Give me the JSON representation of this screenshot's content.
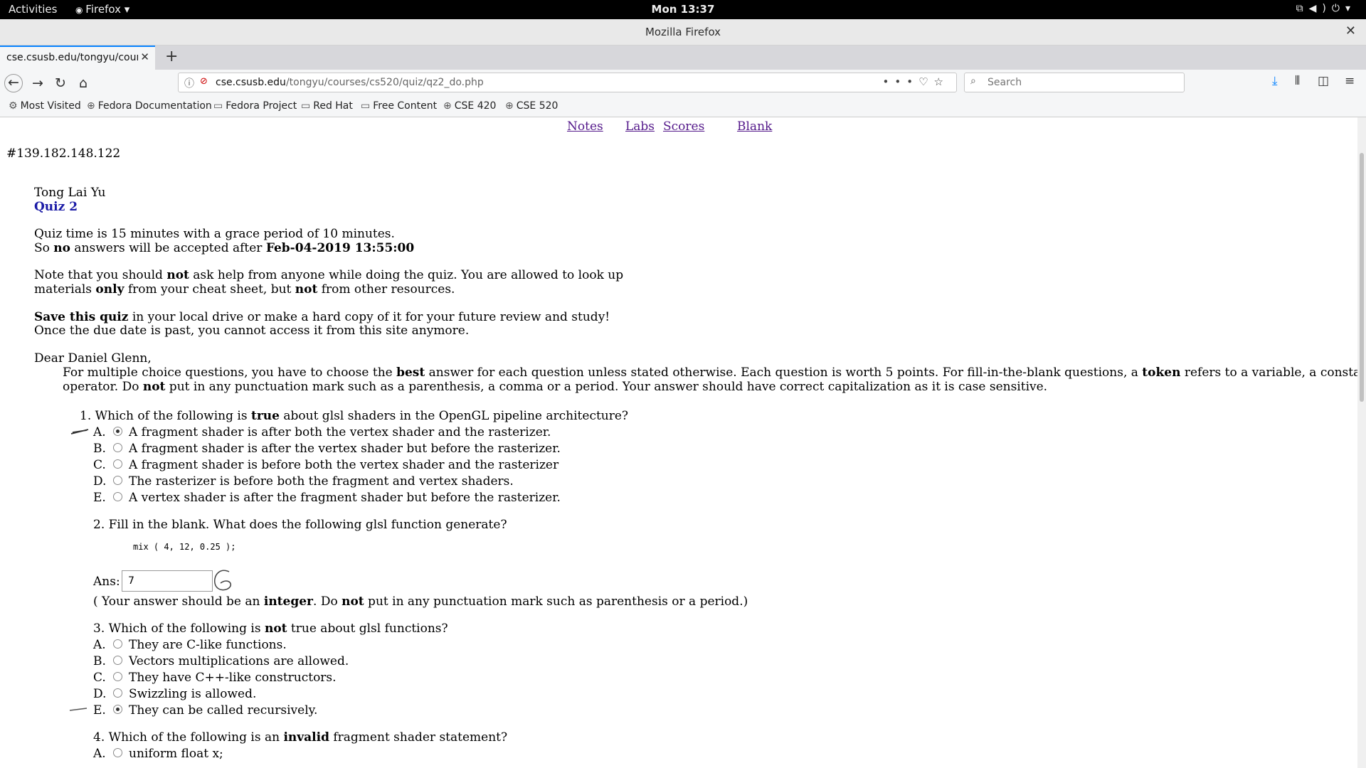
{
  "system": {
    "activities": "Activities",
    "app_menu": "Firefox ▾",
    "clock": "Mon 13:37"
  },
  "window": {
    "title": "Mozilla Firefox"
  },
  "tab": {
    "title": "cse.csusb.edu/tongyu/course"
  },
  "urlbar": {
    "host": "cse.csusb.edu",
    "path": "/tongyu/courses/cs520/quiz/qz2_do.php"
  },
  "search": {
    "placeholder": "Search"
  },
  "bookmarks": [
    {
      "label": "Most Visited",
      "icon": "gear-icon"
    },
    {
      "label": "Fedora Documentation",
      "icon": "globe-icon"
    },
    {
      "label": "Fedora Project",
      "icon": "folder-icon"
    },
    {
      "label": "Red Hat",
      "icon": "folder-icon"
    },
    {
      "label": "Free Content",
      "icon": "folder-icon"
    },
    {
      "label": "CSE 420",
      "icon": "globe-icon"
    },
    {
      "label": "CSE 520",
      "icon": "globe-icon"
    }
  ],
  "page": {
    "top_links": [
      "Notes",
      "Labs",
      "Scores",
      "Blank"
    ],
    "ip": "#139.182.148.122",
    "author": "Tong Lai Yu",
    "quiz_title": "Quiz 2",
    "intro1_a": "Quiz time is 15 minutes with a grace period of 10 minutes.",
    "intro1_b_pre": "So ",
    "intro1_b_bold": "no",
    "intro1_b_mid": " answers will be accepted after ",
    "intro1_b_date": "Feb-04-2019 13:55:00",
    "note_1": "Note that you should ",
    "note_2": "not",
    "note_3": " ask help from anyone while doing the quiz. You are allowed to look up",
    "note_4": "materials ",
    "note_5": "only",
    "note_6": " from your cheat sheet, but ",
    "note_7": "not",
    "note_8": " from other resources.",
    "save_1": "Save this quiz",
    "save_2": " in your local drive or make a hard copy of it for your future review and study!",
    "save_3": "Once the due date is past, you cannot access it from this site anymore.",
    "greeting": "Dear Daniel Glenn,",
    "instr_1": "For multiple choice questions, you have to choose the ",
    "instr_2": "best",
    "instr_3": " answer for each question unless stated otherwise. Each question is worth 5 points. For fill-in-the-blank questions, a ",
    "instr_4": "token",
    "instr_5": " refers to a variable, a constant or an",
    "instr_6": "operator. Do ",
    "instr_7": "not",
    "instr_8": " put in any punctuation mark such as a parenthesis, a comma or a period. Your answer should have correct capitalization as it is case sensitive."
  },
  "questions": {
    "q1": {
      "pre": "1. Which of the following is ",
      "bold": "true",
      "post": " about glsl shaders in the OpenGL pipeline architecture?",
      "options": [
        {
          "letter": "A.",
          "text": "A fragment shader is after both the vertex shader and the rasterizer.",
          "selected": true
        },
        {
          "letter": "B.",
          "text": "A fragment shader is after the vertex shader but before the rasterizer.",
          "selected": false
        },
        {
          "letter": "C.",
          "text": "A fragment shader is before both the vertex shader and the rasterizer",
          "selected": false
        },
        {
          "letter": "D.",
          "text": "The rasterizer is before both the fragment and vertex shaders.",
          "selected": false
        },
        {
          "letter": "E.",
          "text": "A vertex shader is after the fragment shader but before the rasterizer.",
          "selected": false
        }
      ]
    },
    "q2": {
      "text": "2. Fill in the blank. What does the following glsl function generate?",
      "code": "mix ( 4, 12, 0.25 );",
      "ans_label": "Ans:",
      "ans_value": "7",
      "hint_1": "( Your answer should be an ",
      "hint_2": "integer",
      "hint_3": ". Do ",
      "hint_4": "not",
      "hint_5": " put in any punctuation mark such as parenthesis or a period.)"
    },
    "q3": {
      "pre": "3. Which of the following is ",
      "bold": "not",
      "post": " true about glsl functions?",
      "options": [
        {
          "letter": "A.",
          "text": "They are C-like functions.",
          "selected": false
        },
        {
          "letter": "B.",
          "text": "Vectors multiplications are allowed.",
          "selected": false
        },
        {
          "letter": "C.",
          "text": "They have C++-like constructors.",
          "selected": false
        },
        {
          "letter": "D.",
          "text": "Swizzling is allowed.",
          "selected": false
        },
        {
          "letter": "E.",
          "text": "They can be called recursively.",
          "selected": true
        }
      ]
    },
    "q4": {
      "pre": "4. Which of the following is an ",
      "bold": "invalid",
      "post": " fragment shader statement?",
      "options": [
        {
          "letter": "A.",
          "text": "uniform float x;",
          "selected": false
        }
      ]
    }
  }
}
